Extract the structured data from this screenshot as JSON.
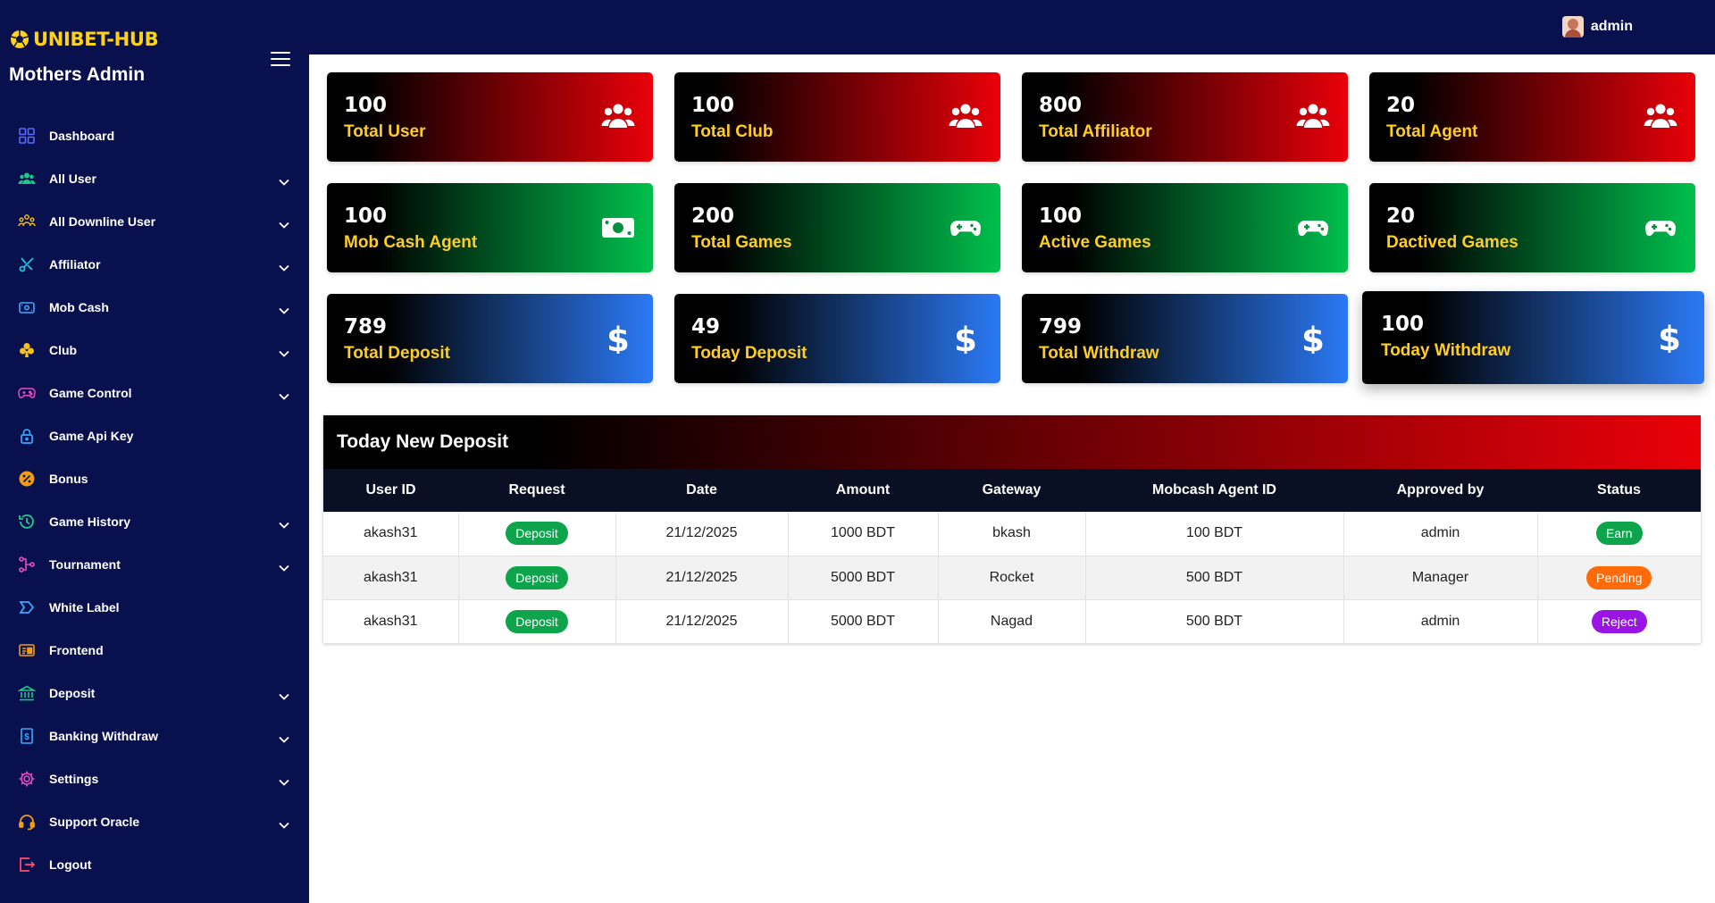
{
  "brand": {
    "name": "UNIBET-HUB",
    "subtitle": "Mothers Admin"
  },
  "topbar": {
    "user": "admin"
  },
  "sidebar": {
    "items": [
      {
        "label": "Dashboard",
        "icon": "grid-icon",
        "color": "#5b6bff",
        "expandable": false
      },
      {
        "label": "All User",
        "icon": "users-icon",
        "color": "#1ec98a",
        "expandable": true
      },
      {
        "label": "All Downline User",
        "icon": "downline-icon",
        "color": "#f5c21b",
        "expandable": true
      },
      {
        "label": "Affiliator",
        "icon": "scissors-icon",
        "color": "#22c5e0",
        "expandable": true
      },
      {
        "label": "Mob Cash",
        "icon": "wallet-icon",
        "color": "#3aa7ff",
        "expandable": true
      },
      {
        "label": "Club",
        "icon": "club-icon",
        "color": "#f5c21b",
        "expandable": true
      },
      {
        "label": "Game Control",
        "icon": "gamepad-icon",
        "color": "#e64cc3",
        "expandable": true
      },
      {
        "label": "Game Api Key",
        "icon": "lock-icon",
        "color": "#3aa7ff",
        "expandable": false
      },
      {
        "label": "Bonus",
        "icon": "bonus-icon",
        "color": "#f39c12",
        "expandable": false
      },
      {
        "label": "Game History",
        "icon": "history-icon",
        "color": "#1ec98a",
        "expandable": true
      },
      {
        "label": "Tournament",
        "icon": "tournament-icon",
        "color": "#e64cc3",
        "expandable": true
      },
      {
        "label": "White Label",
        "icon": "label-icon",
        "color": "#3aa7ff",
        "expandable": false
      },
      {
        "label": "Frontend",
        "icon": "frontend-icon",
        "color": "#f39c12",
        "expandable": false
      },
      {
        "label": "Deposit",
        "icon": "bank-icon",
        "color": "#1ec98a",
        "expandable": true
      },
      {
        "label": "Banking Withdraw",
        "icon": "withdraw-icon",
        "color": "#3aa7ff",
        "expandable": true
      },
      {
        "label": "Settings",
        "icon": "gear-icon",
        "color": "#e64cc3",
        "expandable": true
      },
      {
        "label": "Support Oracle",
        "icon": "headset-icon",
        "color": "#f39c12",
        "expandable": true
      },
      {
        "label": "Logout",
        "icon": "logout-icon",
        "color": "#ff4d6d",
        "expandable": false
      }
    ]
  },
  "cards": [
    {
      "value": "100",
      "label": "Total User",
      "theme": "red",
      "icon": "users-icon"
    },
    {
      "value": "100",
      "label": "Total Club",
      "theme": "red",
      "icon": "users-icon"
    },
    {
      "value": "800",
      "label": "Total Affiliator",
      "theme": "red",
      "icon": "users-icon"
    },
    {
      "value": "20",
      "label": "Total Agent",
      "theme": "red",
      "icon": "users-icon"
    },
    {
      "value": "100",
      "label": "Mob Cash Agent",
      "theme": "green",
      "icon": "money-icon"
    },
    {
      "value": "200",
      "label": "Total Games",
      "theme": "green",
      "icon": "gamepad-icon"
    },
    {
      "value": "100",
      "label": "Active Games",
      "theme": "green",
      "icon": "gamepad-icon"
    },
    {
      "value": "20",
      "label": "Dactived Games",
      "theme": "green",
      "icon": "gamepad-icon"
    },
    {
      "value": "789",
      "label": "Total Deposit",
      "theme": "blue",
      "icon": "dollar-icon"
    },
    {
      "value": "49",
      "label": "Today Deposit",
      "theme": "blue",
      "icon": "dollar-icon"
    },
    {
      "value": "799",
      "label": "Total Withdraw",
      "theme": "blue",
      "icon": "dollar-icon"
    },
    {
      "value": "100",
      "label": "Today Withdraw",
      "theme": "blue",
      "icon": "dollar-icon"
    }
  ],
  "deposit_table": {
    "title": "Today New Deposit",
    "columns": [
      "User ID",
      "Request",
      "Date",
      "Amount",
      "Gateway",
      "Mobcash Agent ID",
      "Approved by",
      "Status"
    ],
    "rows": [
      {
        "user_id": "akash31",
        "request": "Deposit",
        "date": "21/12/2025",
        "amount": "1000 BDT",
        "gateway": "bkash",
        "agent_id": "100 BDT",
        "approved_by": "admin",
        "status": "Earn",
        "status_color": "#0ea44c"
      },
      {
        "user_id": "akash31",
        "request": "Deposit",
        "date": "21/12/2025",
        "amount": "5000 BDT",
        "gateway": "Rocket",
        "agent_id": "500 BDT",
        "approved_by": "Manager",
        "status": "Pending",
        "status_color": "#ff6b0b"
      },
      {
        "user_id": "akash31",
        "request": "Deposit",
        "date": "21/12/2025",
        "amount": "5000 BDT",
        "gateway": "Nagad",
        "agent_id": "500 BDT",
        "approved_by": "admin",
        "status": "Reject",
        "status_color": "#9b14e6"
      }
    ]
  }
}
